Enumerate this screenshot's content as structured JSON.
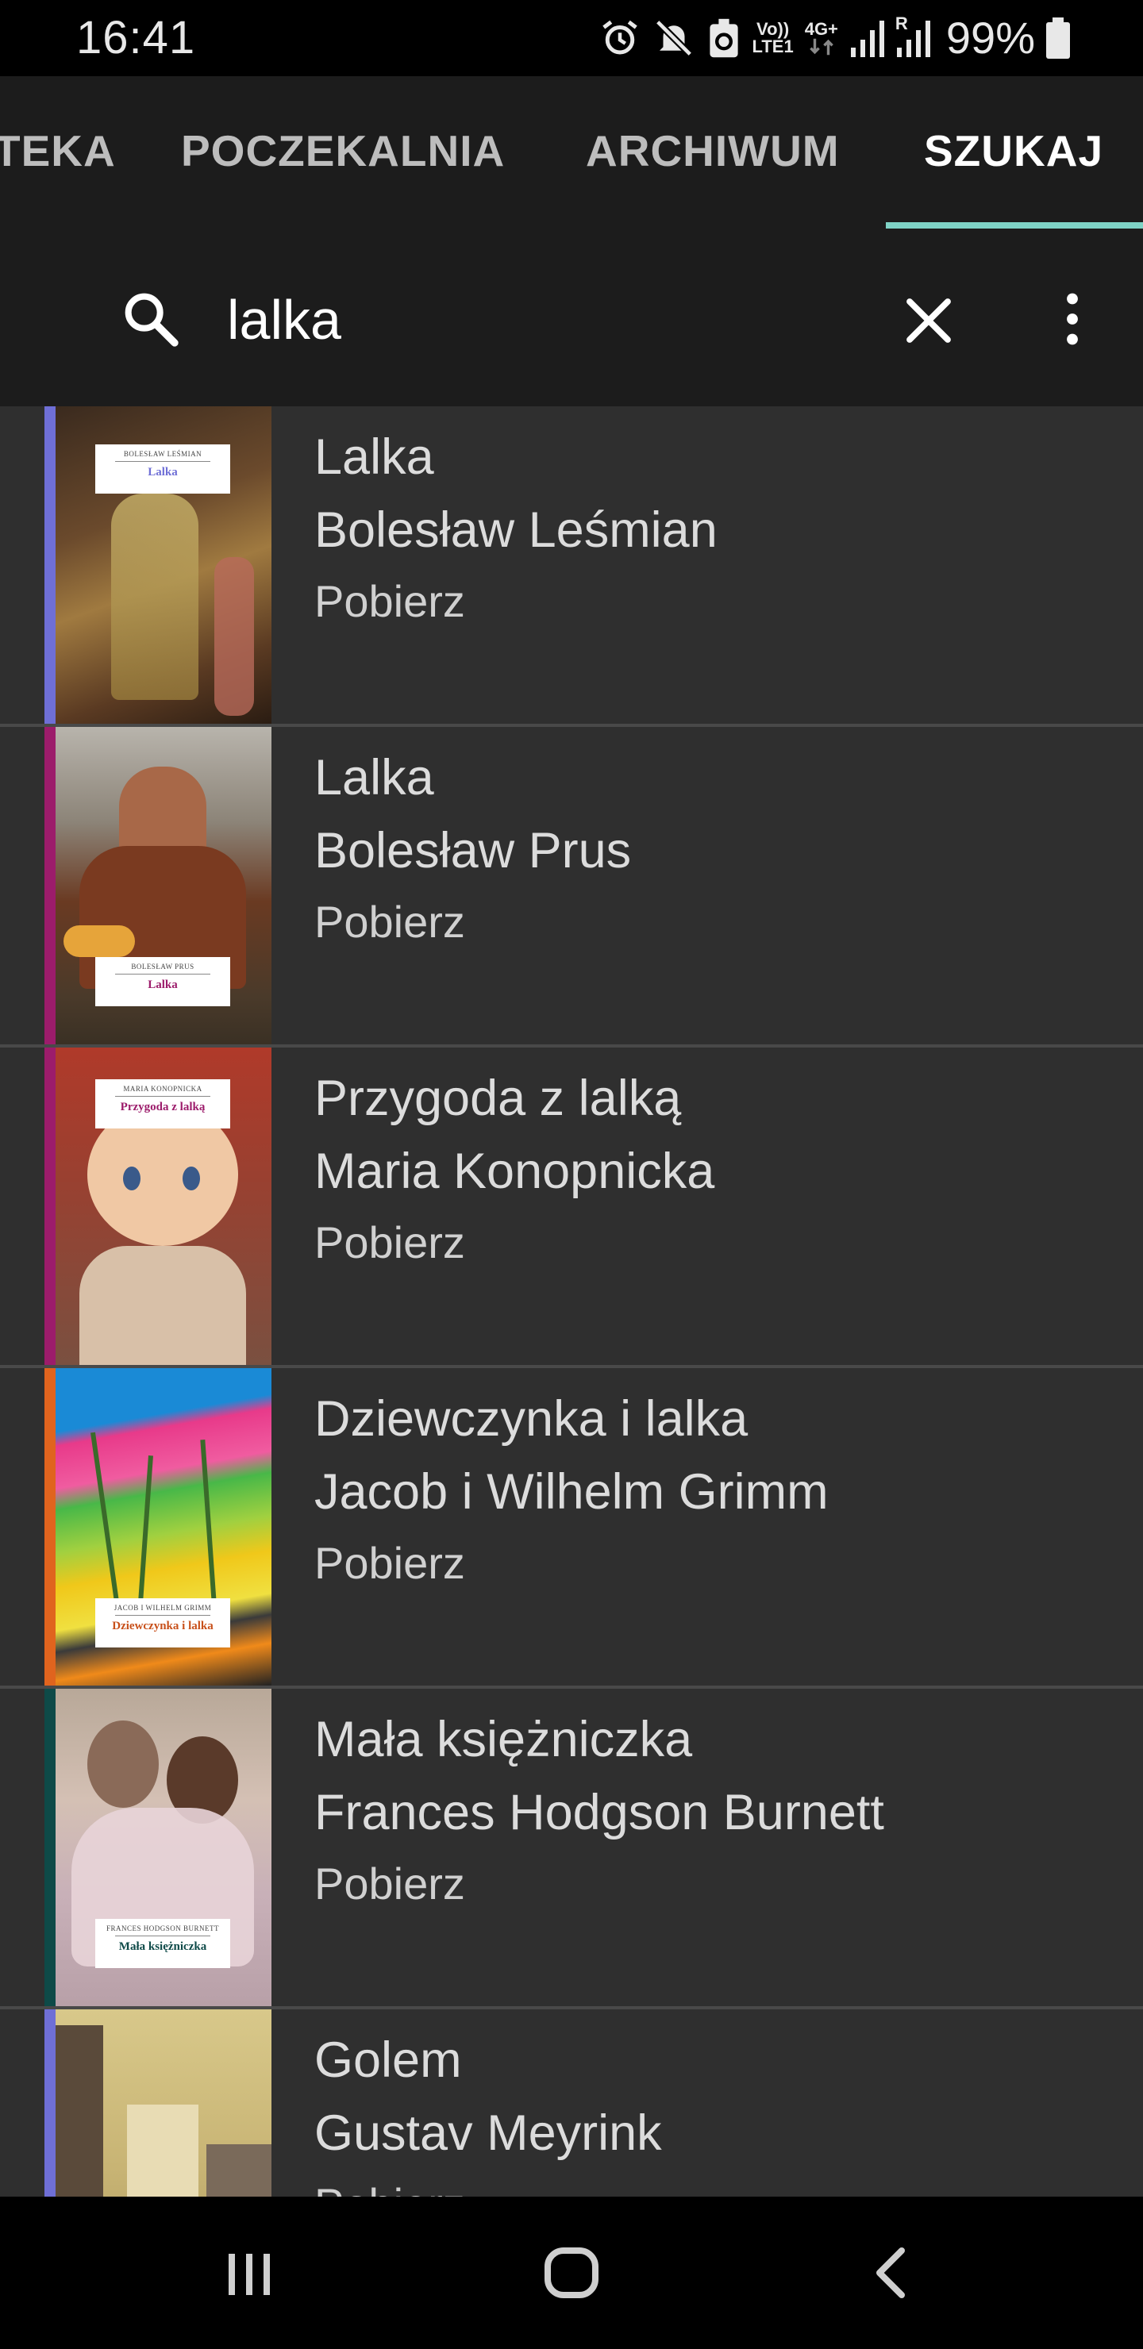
{
  "status_bar": {
    "time": "16:41",
    "network_top": "Vo))",
    "network_bottom": "LTE1",
    "network_type": "4G+",
    "roaming": "R",
    "battery_percent": "99%",
    "icons": [
      "alarm-icon",
      "mute-icon",
      "recycle-icon",
      "signal-icon",
      "signal-roaming-icon",
      "battery-icon"
    ]
  },
  "tabs": [
    {
      "label": "TEKA",
      "active": false
    },
    {
      "label": "POCZEKALNIA",
      "active": false
    },
    {
      "label": "ARCHIWUM",
      "active": false
    },
    {
      "label": "SZUKAJ",
      "active": true
    }
  ],
  "colors": {
    "tab_indicator": "#7fd3c6",
    "toolbar_bg": "#1c1c1c",
    "list_bg": "#2f2f2f"
  },
  "search": {
    "query": "lalka",
    "icons": [
      "search-icon",
      "close-icon",
      "more-vert-icon"
    ]
  },
  "results": [
    {
      "title": "Lalka",
      "author": "Bolesław Leśmian",
      "action": "Pobierz",
      "accent_color": "#6f6fd6",
      "cover_author": "BOLESŁAW LEŚMIAN",
      "cover_title": "Lalka",
      "cover_title_color": "#6f6fd6"
    },
    {
      "title": "Lalka",
      "author": "Bolesław Prus",
      "action": "Pobierz",
      "accent_color": "#9c1c6b",
      "cover_author": "BOLESŁAW PRUS",
      "cover_title": "Lalka",
      "cover_title_color": "#9c1c6b"
    },
    {
      "title": "Przygoda z lalką",
      "author": "Maria Konopnicka",
      "action": "Pobierz",
      "accent_color": "#9c1c6b",
      "cover_author": "MARIA KONOPNICKA",
      "cover_title": "Przygoda z lalką",
      "cover_title_color": "#9c1c6b"
    },
    {
      "title": "Dziewczynka i lalka",
      "author": "Jacob i Wilhelm Grimm",
      "action": "Pobierz",
      "accent_color": "#e0641e",
      "cover_author": "JACOB I WILHELM GRIMM",
      "cover_title": "Dziewczynka i lalka",
      "cover_title_color": "#c8501a"
    },
    {
      "title": "Mała księżniczka",
      "author": "Frances Hodgson Burnett",
      "action": "Pobierz",
      "accent_color": "#0e4a48",
      "cover_author": "FRANCES HODGSON BURNETT",
      "cover_title": "Mała księżniczka",
      "cover_title_color": "#0e4a48"
    },
    {
      "title": "Golem",
      "author": "Gustav Meyrink",
      "action": "Pobierz",
      "accent_color": "#6f6fd6"
    }
  ],
  "nav_bar": {
    "icons": [
      "recent-apps-icon",
      "home-icon",
      "back-icon"
    ]
  }
}
